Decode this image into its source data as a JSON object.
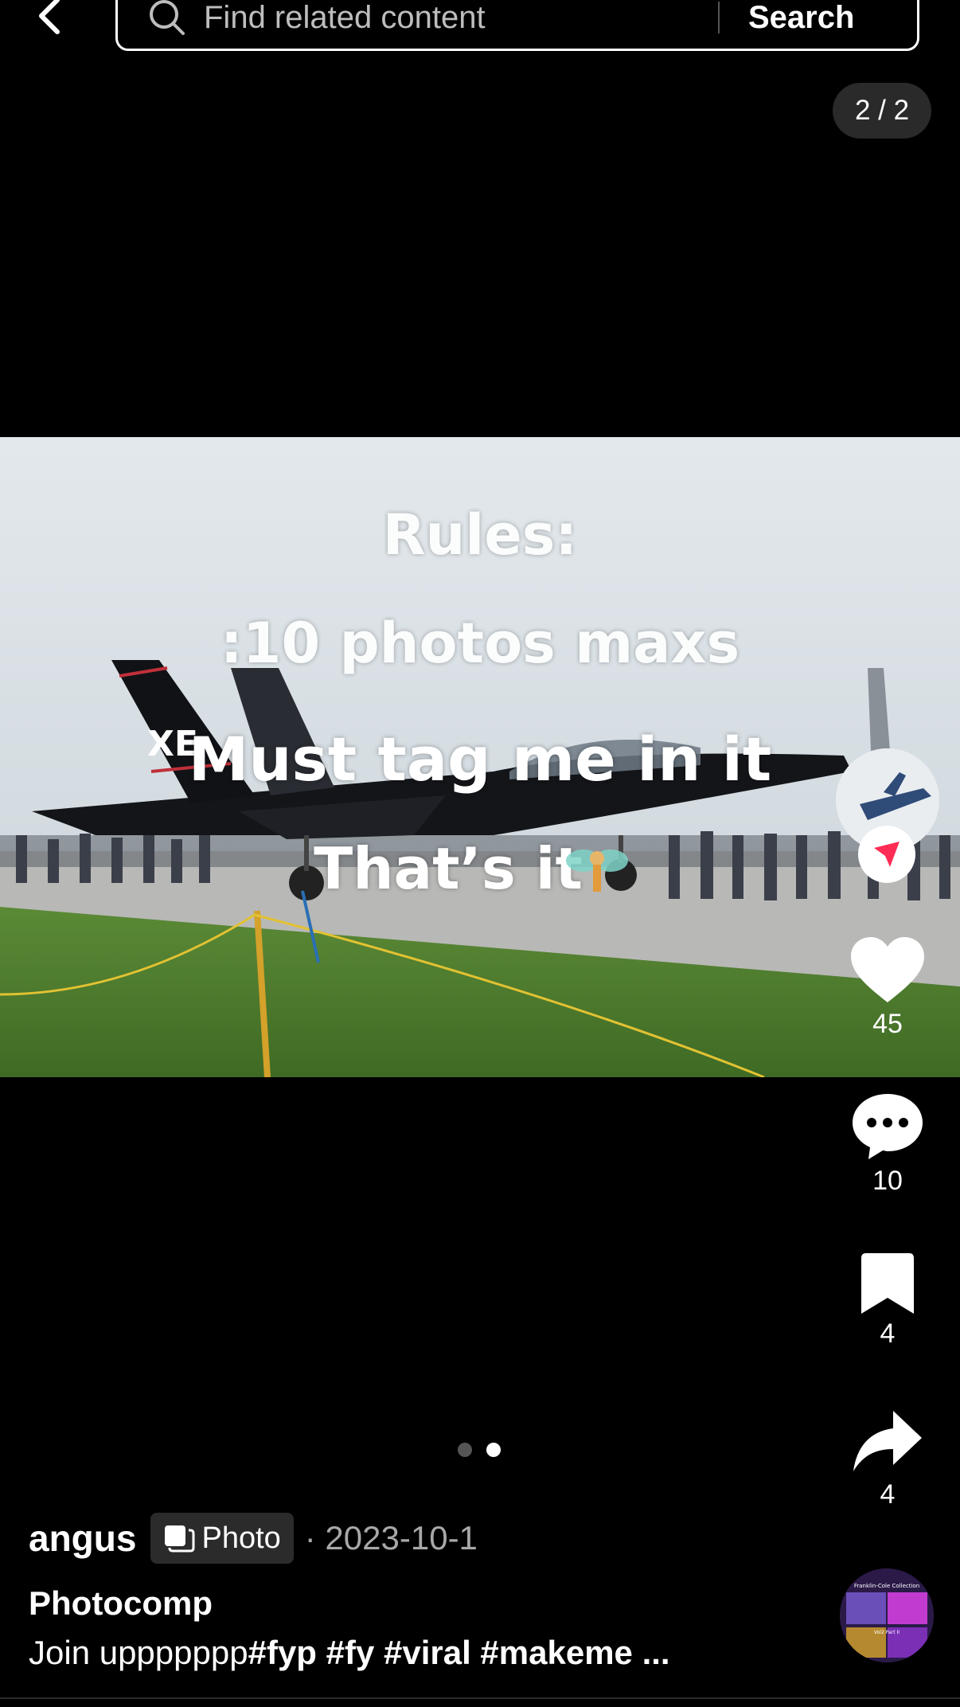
{
  "search": {
    "placeholder": "Find related content",
    "button_label": "Search"
  },
  "gallery": {
    "page_counter": "2 / 2",
    "current_page": 2,
    "total_pages": 2
  },
  "photo": {
    "overlay_lines": [
      "Rules:",
      ":10 photos maxs",
      "Must tag me in it",
      "That’s it"
    ],
    "aircraft_tail_mark": "XE"
  },
  "actions": {
    "likes": "45",
    "comments": "10",
    "saves": "4",
    "shares": "4"
  },
  "post": {
    "author": "angus",
    "type_badge": "Photo",
    "date": "· 2023-10-1",
    "title": "Photocomp",
    "caption_text": "Join uppppppp",
    "caption_tags": "#fyp #fy #viral #makeme ..."
  },
  "music": {
    "disc_text_top": "Franklin-Cole Collection",
    "disc_text_bottom": "Vol2 Part II"
  },
  "colors": {
    "background": "#000000",
    "follow_accent": "#fe2c55",
    "sky": "#dfe5ea",
    "grass": "#4e7a2e"
  }
}
